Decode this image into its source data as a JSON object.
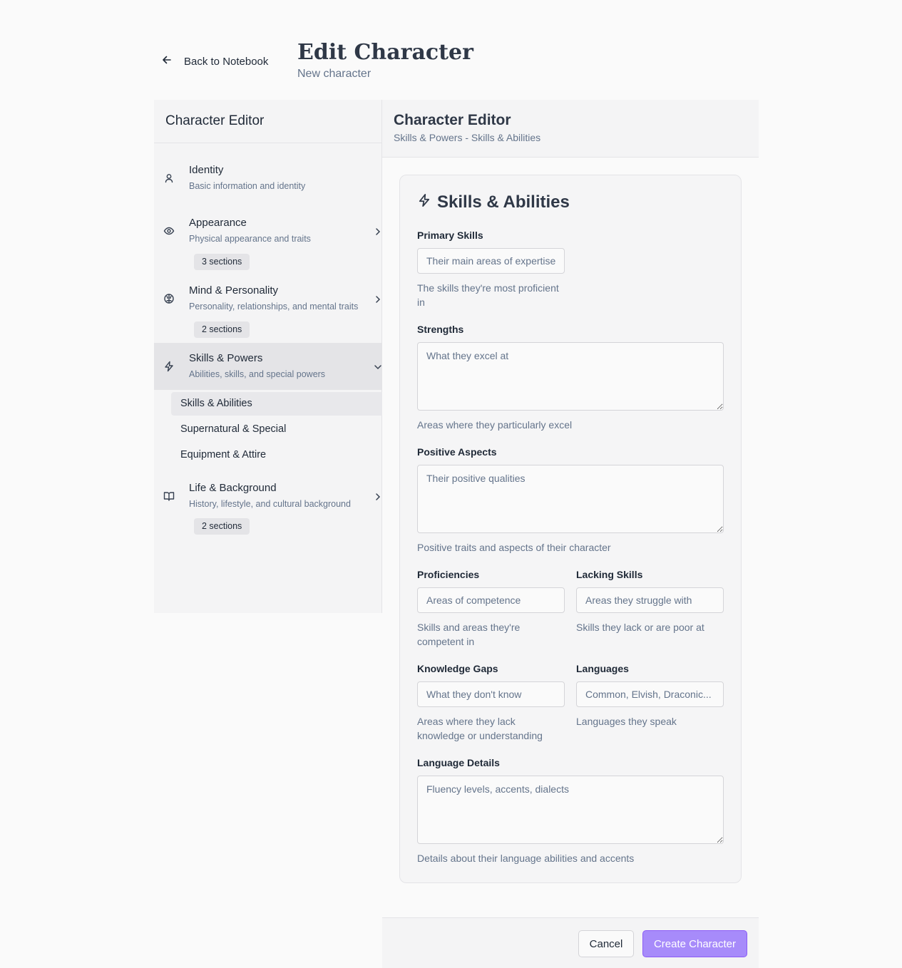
{
  "header": {
    "back_label": "Back to Notebook",
    "title": "Edit Character",
    "subtitle": "New character"
  },
  "sidebar": {
    "title": "Character Editor",
    "items": [
      {
        "label": "Identity",
        "desc": "Basic information and identity",
        "icon": "user-icon"
      },
      {
        "label": "Appearance",
        "desc": "Physical appearance and traits",
        "badge": "3 sections",
        "icon": "eye-icon"
      },
      {
        "label": "Mind & Personality",
        "desc": "Personality, relationships, and mental traits",
        "badge": "2 sections",
        "icon": "brain-icon"
      },
      {
        "label": "Skills & Powers",
        "desc": "Abilities, skills, and special powers",
        "icon": "lightning-icon",
        "sub": [
          "Skills & Abilities",
          "Supernatural & Special",
          "Equipment & Attire"
        ]
      },
      {
        "label": "Life & Background",
        "desc": "History, lifestyle, and cultural background",
        "badge": "2 sections",
        "icon": "book-icon"
      }
    ]
  },
  "main": {
    "title": "Character Editor",
    "breadcrumb": "Skills & Powers - Skills & Abilities",
    "card_title": "Skills & Abilities",
    "fields": {
      "primary_skills": {
        "label": "Primary Skills",
        "placeholder": "Their main areas of expertise",
        "hint": "The skills they're most proficient in"
      },
      "strengths": {
        "label": "Strengths",
        "placeholder": "What they excel at",
        "hint": "Areas where they particularly excel"
      },
      "positive_aspects": {
        "label": "Positive Aspects",
        "placeholder": "Their positive qualities",
        "hint": "Positive traits and aspects of their character"
      },
      "proficiencies": {
        "label": "Proficiencies",
        "placeholder": "Areas of competence",
        "hint": "Skills and areas they're competent in"
      },
      "lacking_skills": {
        "label": "Lacking Skills",
        "placeholder": "Areas they struggle with",
        "hint": "Skills they lack or are poor at"
      },
      "knowledge_gaps": {
        "label": "Knowledge Gaps",
        "placeholder": "What they don't know",
        "hint": "Areas where they lack knowledge or understanding"
      },
      "languages": {
        "label": "Languages",
        "placeholder": "Common, Elvish, Draconic...",
        "hint": "Languages they speak"
      },
      "language_details": {
        "label": "Language Details",
        "placeholder": "Fluency levels, accents, dialects",
        "hint": "Details about their language abilities and accents"
      }
    }
  },
  "footer": {
    "cancel_label": "Cancel",
    "create_label": "Create Character"
  },
  "colors": {
    "accent": "#a78bfa",
    "sidebar_bg": "#f4f4f5",
    "active_bg": "#e4e4e7"
  }
}
